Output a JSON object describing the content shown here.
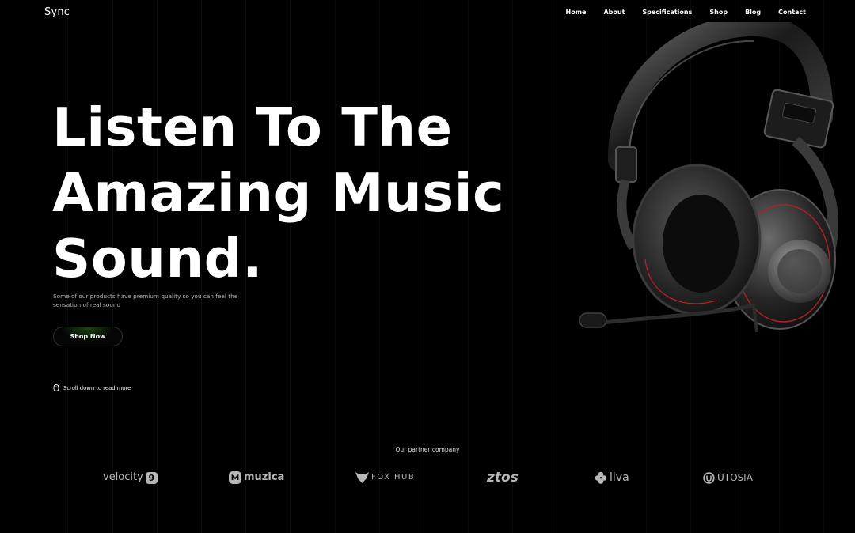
{
  "brand": {
    "logo": "Sync"
  },
  "nav": {
    "items": [
      "Home",
      "About",
      "Specifications",
      "Shop",
      "Blog",
      "Contact"
    ]
  },
  "hero": {
    "title_lines": [
      "Listen To The",
      "Amazing Music",
      "Sound."
    ],
    "subtitle": "Some of our products have premium quality so you can feel the sensation of real sound",
    "cta_label": "Shop Now",
    "scroll_hint": "Scroll down to read more"
  },
  "partners": {
    "label": "Our partner company",
    "logos": [
      {
        "name": "velocity",
        "badge": "9",
        "icon": "velocity-badge-icon"
      },
      {
        "name": "muzica",
        "icon": "muzica-logo-icon"
      },
      {
        "name": "FOX HUB",
        "icon": "fox-logo-icon"
      },
      {
        "name": "ztos"
      },
      {
        "name": "liva",
        "icon": "liva-logo-icon"
      },
      {
        "name": "UTOSIA",
        "icon": "utosia-logo-icon"
      }
    ]
  },
  "colors": {
    "background": "#000000",
    "text": "#ffffff",
    "muted_text": "#bdbdbd",
    "partner_logo": "#b7b7b7",
    "button_glow": "#4abe28",
    "headphone_accent": "#b3202a"
  }
}
